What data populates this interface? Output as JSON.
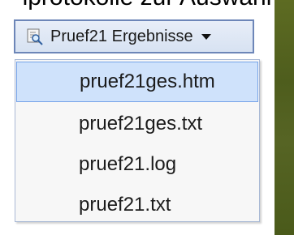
{
  "background": {
    "caption": "lprotokolle zur Auswahl"
  },
  "toolbar": {
    "dropdown_label": "Pruef21 Ergebnisse",
    "icon": "preview-icon"
  },
  "menu": {
    "items": [
      {
        "label": "pruef21ges.htm",
        "selected": true
      },
      {
        "label": "pruef21ges.txt",
        "selected": false
      },
      {
        "label": "pruef21.log",
        "selected": false
      },
      {
        "label": "pruef21.txt",
        "selected": false
      }
    ]
  },
  "colors": {
    "menu_selection": "#cfe2fb",
    "menu_selection_border": "#75a3e8",
    "button_border": "#6d86b8",
    "button_fill": "#dfe7f5",
    "background_strip": "#566424"
  }
}
